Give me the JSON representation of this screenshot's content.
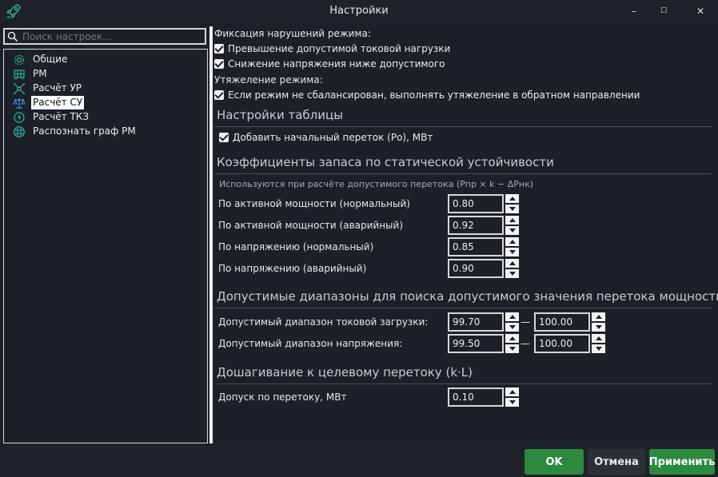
{
  "window": {
    "title": "Настройки",
    "minimize": "–",
    "maximize": "☐",
    "close": "✕"
  },
  "search": {
    "placeholder": "Поиск настроек..."
  },
  "tree": [
    {
      "label": "Общие",
      "icon": "gear-icon"
    },
    {
      "label": "РМ",
      "icon": "grid-icon"
    },
    {
      "label": "Расчёт УР",
      "icon": "network-icon"
    },
    {
      "label": "Расчёт СУ",
      "icon": "scales-icon",
      "selected": true
    },
    {
      "label": "Расчёт ТКЗ",
      "icon": "lightning-icon"
    },
    {
      "label": "Распознать граф РМ",
      "icon": "graph-icon"
    }
  ],
  "settings": {
    "violations_label": "Фиксация нарушений режима:",
    "cb_overload": "Превышение допустимой токовой нагрузки",
    "cb_voltage": "Снижение напряжения ниже допустимого",
    "weighting_label": "Утяжеление режима:",
    "cb_reverse": "Если режим не сбалансирован, выполнять утяжеление в обратном направлении",
    "table_section": "Настройки таблицы",
    "cb_initial_flow": "Добавить начальный переток (Ро), МВт",
    "coef_section": "Коэффициенты запаса по статической устойчивости",
    "coef_note": "Используются при расчёте допустимого перетока (Рпр × k − ΔРнк)",
    "coef_rows": [
      {
        "label": "По активной мощности (нормальный)",
        "value": "0.80"
      },
      {
        "label": "По активной мощности (аварийный)",
        "value": "0.92"
      },
      {
        "label": "По напряжению (нормальный)",
        "value": "0.85"
      },
      {
        "label": "По напряжению (аварийный)",
        "value": "0.90"
      }
    ],
    "ranges_section": "Допустимые диапазоны для поиска допустимого значения перетока мощности",
    "range_rows": [
      {
        "label": "Допустимый диапазон токовой загрузки:",
        "from": "99.70",
        "to": "100.00"
      },
      {
        "label": "Допустимый диапазон напряжения:",
        "from": "99.50",
        "to": "100.00"
      }
    ],
    "range_dash": "—",
    "step_section": "Дошагивание к целевому перетоку (k·L)",
    "tolerance_label": "Допуск по перетоку, МВт",
    "tolerance_value": "0.10"
  },
  "footer": {
    "ok": "OK",
    "cancel": "Отмена",
    "apply": "Применить"
  },
  "colors": {
    "accent": "#2b8a3e",
    "background": "#1c2128",
    "icon_teal": "#2fb9a3"
  }
}
